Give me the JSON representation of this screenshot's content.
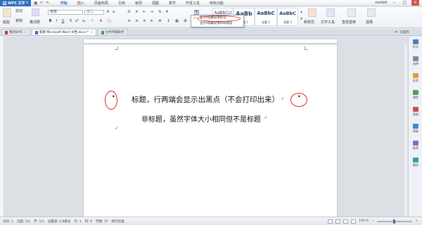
{
  "titlebar": {
    "app_name": "WPS 文字",
    "menus": [
      "开始",
      "插入",
      "页面布局",
      "引用",
      "审阅",
      "视图",
      "章节",
      "开发工具",
      "特色功能"
    ],
    "active_menu": "开始",
    "user": "mollett",
    "minimize": "–",
    "maximize": "□",
    "close": "×"
  },
  "ribbon": {
    "paste": "粘贴",
    "cut": "剪切",
    "copy": "复制",
    "format_painter": "格式刷",
    "font_name": "宋体",
    "font_size": "小二",
    "bold": "B",
    "italic": "I",
    "underline": "U",
    "styles": [
      {
        "preview": "AaBbCcI",
        "name": "正文"
      },
      {
        "preview": "AaBb",
        "name": "标题 1"
      },
      {
        "preview": "AaBbC",
        "name": "标题 2"
      },
      {
        "preview": "AaBbC",
        "name": "标题 3"
      }
    ],
    "new_style": "新样式",
    "text_tools": "文字工具",
    "find_replace": "查找替换",
    "select": "选择",
    "popup_items": [
      {
        "label": "显示/隐藏段落标记",
        "checked": true
      },
      {
        "label": "显示/隐藏段落布局按钮",
        "checked": false
      }
    ]
  },
  "tabs": {
    "items": [
      {
        "label": "我的WPS",
        "active": false
      },
      {
        "label": "新建 Microsoft Word 文档.docx *",
        "active": true
      },
      {
        "label": "文件传输助手",
        "active": false
      }
    ],
    "right": "云服务"
  },
  "document": {
    "line1": "标题，行两端会显示出黑点（不会打印出来）",
    "line2": "非标题，虽然字体大小相同但不是标题",
    "pilcrow": "↲",
    "dot": "•"
  },
  "sidebar": {
    "items": [
      "样式",
      "选择",
      "形状",
      "属性",
      "限制",
      "帮助",
      "推荐",
      "备份"
    ]
  },
  "status": {
    "page": "页码: 1",
    "pages": "页面: 1/1",
    "section": "节: 1/1",
    "setting": "设置值: 3.8厘米",
    "row": "行: 1",
    "col": "列: 9",
    "words": "字数: 37",
    "spell": "拼写检查",
    "zoom": "100 %"
  },
  "colors": {
    "accent": "#2e6fbe",
    "annotation_red": "#e02020"
  }
}
